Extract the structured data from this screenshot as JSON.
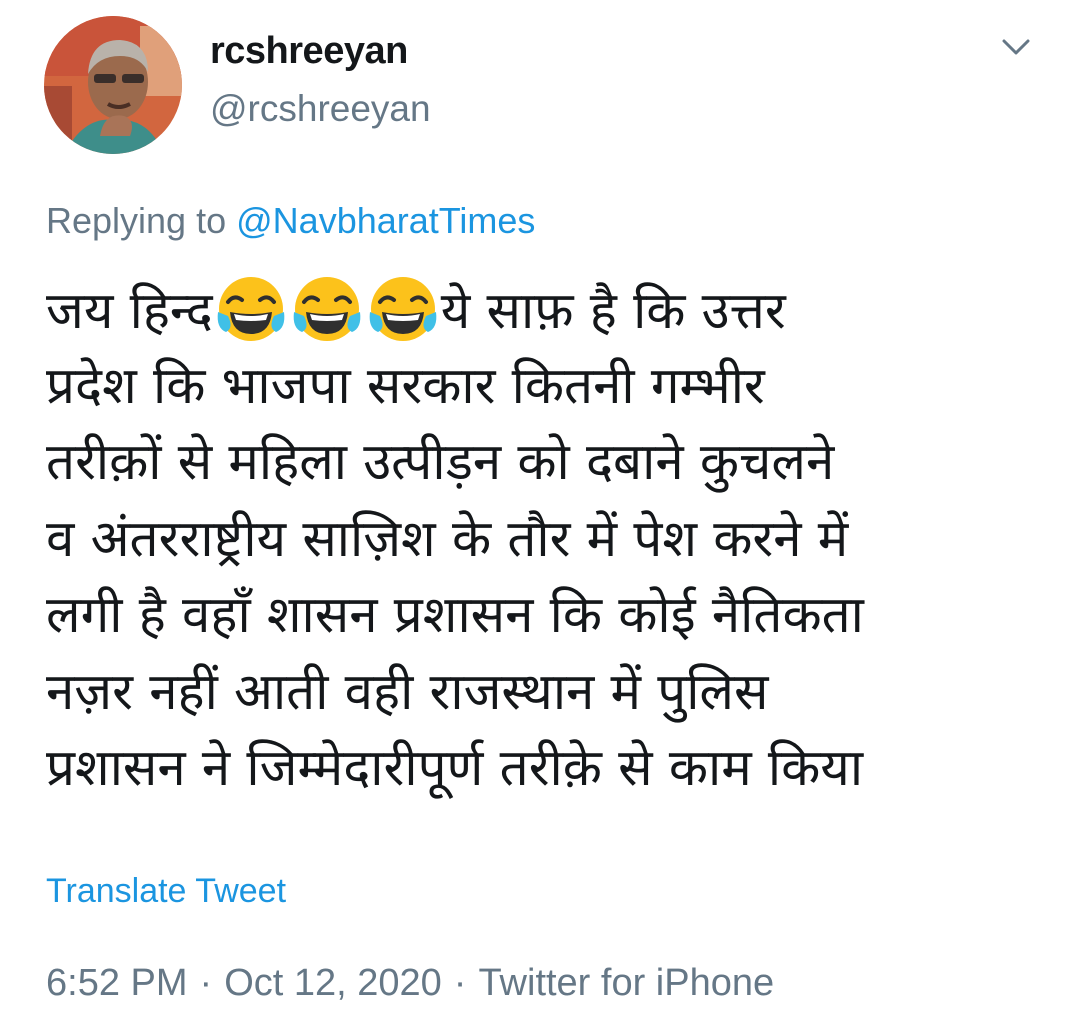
{
  "author": {
    "display_name": "rcshreeyan",
    "handle": "@rcshreeyan",
    "avatar_icon": "profile-photo"
  },
  "header": {
    "more_icon": "chevron-down-icon"
  },
  "reply": {
    "prefix": "Replying to",
    "mention": "@NavbharatTimes"
  },
  "tweet": {
    "line1_pre": "जय हिन्द",
    "line1_post": "ये साफ़ है कि उत्तर",
    "emoji_icon": "face-with-tears-of-joy-emoji",
    "lines": [
      "प्रदेश कि भाजपा सरकार कितनी गम्भीर",
      "तरीक़ों से महिला उत्पीड़न को दबाने कुचलने",
      "व अंतरराष्ट्रीय साज़िश के तौर में पेश करने में",
      "लगी है वहाँ शासन प्रशासन कि कोई नैतिकता",
      "नज़र नहीं आती वही राजस्थान में पुलिस",
      "प्रशासन ने जिम्मेदारीपूर्ण तरीक़े से काम किया"
    ]
  },
  "translate_label": "Translate Tweet",
  "meta": {
    "time": "6:52 PM",
    "date": "Oct 12, 2020",
    "separator": "·",
    "source": "Twitter for iPhone"
  },
  "colors": {
    "text": "#14171a",
    "secondary": "#657786",
    "link": "#1b95e0"
  }
}
